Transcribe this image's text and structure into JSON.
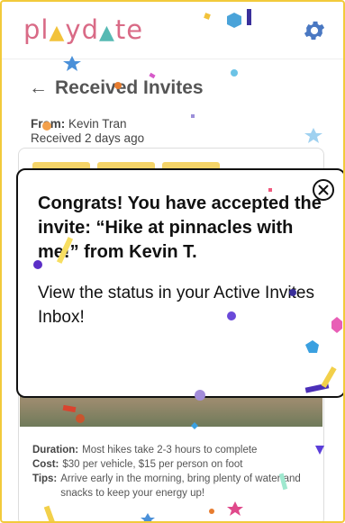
{
  "app": {
    "logo_parts": [
      "pl",
      "y",
      "d",
      "te"
    ],
    "accent": "#d96a86",
    "yellow": "#f2c23a",
    "teal": "#56b9b3",
    "gear_color": "#4a78c2"
  },
  "page": {
    "back_arrow": "←",
    "title": "Received Invites",
    "from_label": "From:",
    "from_value": "Kevin Tran",
    "received": "Received 2 days ago"
  },
  "details": {
    "duration_label": "Duration:",
    "duration_value": "Most hikes take 2-3 hours to complete",
    "cost_label": "Cost:",
    "cost_value": "$30 per vehicle, $15 per person on foot",
    "tips_label": "Tips:",
    "tips_value": "Arrive early in the morning, bring plenty of water and snacks to keep your energy up!"
  },
  "modal": {
    "heading": "Congrats! You have accepted the invite: “Hike at pinnacles with me!” from Kevin T.",
    "body": "View the status in your Active Invites Inbox!",
    "close_icon": "close-circle-icon"
  }
}
